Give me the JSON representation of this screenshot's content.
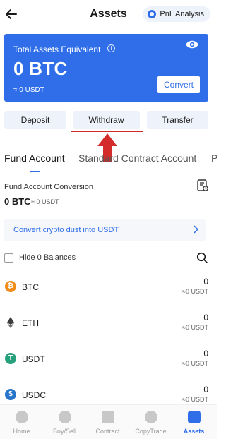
{
  "header": {
    "title": "Assets",
    "pnl_button": "PnL Analysis"
  },
  "card": {
    "label": "Total Assets Equivalent",
    "info_glyph": "i",
    "total": "0 BTC",
    "sub": "≈ 0 USDT",
    "convert_button": "Convert",
    "bg_color": "#2f6ee8"
  },
  "actions": {
    "deposit": "Deposit",
    "withdraw": "Withdraw",
    "transfer": "Transfer"
  },
  "tabs": [
    "Fund Account",
    "Standard Contract Account",
    "P"
  ],
  "conversion": {
    "label": "Fund Account Conversion",
    "value": "0 BTC",
    "sub": "≈ 0 USDT"
  },
  "dust_banner": "Convert crypto dust into USDT",
  "hide_balances_label": "Hide 0 Balances",
  "assets": [
    {
      "symbol": "BTC",
      "amount": "0",
      "usdt": "≈0 USDT",
      "color": "#f08c1a",
      "glyph": "₿"
    },
    {
      "symbol": "ETH",
      "amount": "0",
      "usdt": "≈0 USDT",
      "color": "#3c3c3d",
      "glyph": "◆"
    },
    {
      "symbol": "USDT",
      "amount": "0",
      "usdt": "≈0 USDT",
      "color": "#26a17b",
      "glyph": "T"
    },
    {
      "symbol": "USDC",
      "amount": "0",
      "usdt": "≈0 USDT",
      "color": "#2775ca",
      "glyph": "$"
    }
  ],
  "bottom_nav": [
    {
      "label": "Home",
      "icon": "home-icon"
    },
    {
      "label": "Buy/Sell",
      "icon": "buy-sell-icon"
    },
    {
      "label": "Contract",
      "icon": "contract-icon"
    },
    {
      "label": "CopyTrade",
      "icon": "copytrade-icon"
    },
    {
      "label": "Assets",
      "icon": "assets-icon"
    }
  ],
  "annotation_color": "#d42b2b"
}
